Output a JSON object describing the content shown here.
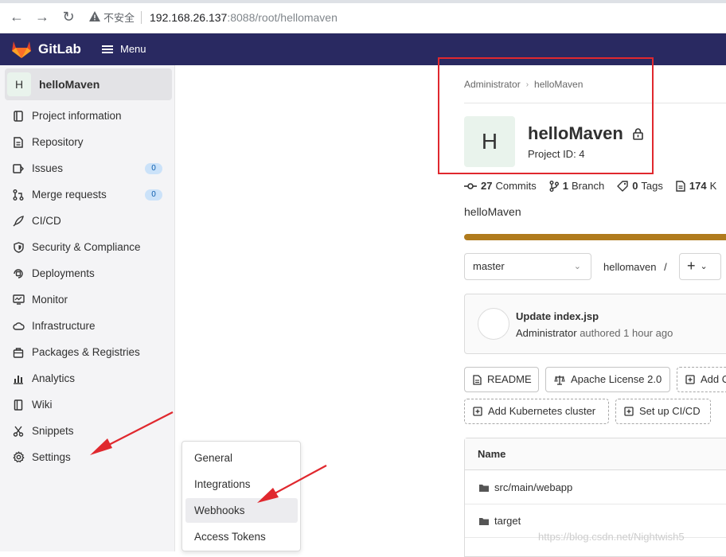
{
  "browser": {
    "insecure_label": "不安全",
    "url_host": "192.168.26.137",
    "url_path": ":8088/root/hellomaven"
  },
  "header": {
    "brand": "GitLab",
    "menu_label": "Menu"
  },
  "sidebar": {
    "project_initial": "H",
    "project_name": "helloMaven",
    "items": [
      {
        "label": "Project information",
        "icon": "info-icon"
      },
      {
        "label": "Repository",
        "icon": "document-icon"
      },
      {
        "label": "Issues",
        "icon": "issues-icon",
        "badge": "0"
      },
      {
        "label": "Merge requests",
        "icon": "merge-request-icon",
        "badge": "0"
      },
      {
        "label": "CI/CD",
        "icon": "rocket-icon"
      },
      {
        "label": "Security & Compliance",
        "icon": "shield-icon"
      },
      {
        "label": "Deployments",
        "icon": "deployments-icon"
      },
      {
        "label": "Monitor",
        "icon": "monitor-icon"
      },
      {
        "label": "Infrastructure",
        "icon": "cloud-icon"
      },
      {
        "label": "Packages & Registries",
        "icon": "package-icon"
      },
      {
        "label": "Analytics",
        "icon": "chart-icon"
      },
      {
        "label": "Wiki",
        "icon": "book-icon"
      },
      {
        "label": "Snippets",
        "icon": "scissors-icon"
      },
      {
        "label": "Settings",
        "icon": "gear-icon"
      }
    ]
  },
  "settings_flyout": {
    "items": [
      "General",
      "Integrations",
      "Webhooks",
      "Access Tokens"
    ],
    "active": "Webhooks"
  },
  "project": {
    "breadcrumb": [
      "Administrator",
      "helloMaven"
    ],
    "initial": "H",
    "name": "helloMaven",
    "project_id": "Project ID: 4",
    "stats": [
      {
        "count": "27",
        "label": "Commits",
        "icon": "commit-icon"
      },
      {
        "count": "1",
        "label": "Branch",
        "icon": "branch-icon"
      },
      {
        "count": "0",
        "label": "Tags",
        "icon": "tag-icon"
      },
      {
        "count": "174",
        "label": "K",
        "icon": "file-icon"
      }
    ],
    "description": "helloMaven",
    "language_bar_color": "#b07b1d"
  },
  "repo": {
    "branch": "master",
    "path": "hellomaven",
    "path_sep": "/",
    "plus": "+"
  },
  "last_commit": {
    "title": "Update index.jsp",
    "author": "Administrator",
    "meta": "authored 1 hour ago"
  },
  "buttons": {
    "readme": "README",
    "license": "Apache License 2.0",
    "add": "Add C",
    "kubernetes": "Add Kubernetes cluster",
    "cicd": "Set up CI/CD"
  },
  "files": {
    "header": "Name",
    "rows": [
      "src/main/webapp",
      "target"
    ]
  },
  "watermark": "https://blog.csdn.net/Nightwish5"
}
